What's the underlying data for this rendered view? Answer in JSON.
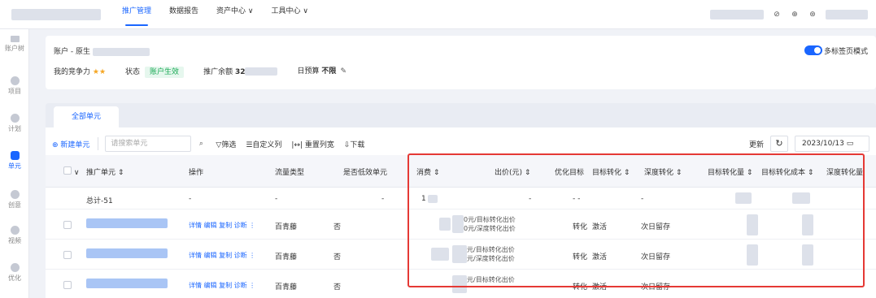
{
  "topbar": {
    "nav": [
      "推广管理",
      "数据报告",
      "资产中心 ∨",
      "工具中心 ∨"
    ],
    "icons": [
      "help-icon",
      "switch-icon",
      "user-icon"
    ]
  },
  "rail": [
    "账户树",
    "项目",
    "计划",
    "单元",
    "创意",
    "视频",
    "优化"
  ],
  "account": {
    "name_prefix": "账户 - 原生",
    "competitiveness_label": "我的竞争力",
    "stars": "★★",
    "status_label": "状态",
    "status_value": "账户生效",
    "balance_label": "推广余额",
    "balance_value": "32",
    "budget_label": "日预算",
    "budget_value": "不限",
    "multi_tab_label": "多标签页模式"
  },
  "tab": {
    "label": "全部单元"
  },
  "toolbar": {
    "new_label": "⊕ 新建单元",
    "search_placeholder": "请搜索单元",
    "filter": "▽筛选",
    "custom": "☰自定义列",
    "reset": "|↔| 重置列宽",
    "download": "⇩下载",
    "refresh_label": "更新",
    "date": "2023/10/13"
  },
  "table": {
    "headers": [
      "推广单元 ⇕",
      "操作",
      "流量类型",
      "是否低效单元",
      "消费 ⇕",
      "出价(元) ⇕",
      "优化目标",
      "目标转化 ⇕",
      "深度转化 ⇕",
      "目标转化量 ⇕",
      "目标转化成本 ⇕",
      "深度转化量"
    ],
    "total_label": "总计-51",
    "total_spend": "1",
    "rows": [
      {
        "ops": "详情 编辑 复制 诊断 ⋮",
        "traffic": "百青藤",
        "low": "否",
        "bid1": "0元/目标转化出价",
        "bid2": "0元/深度转化出价",
        "goal": "转化",
        "target": "激活",
        "deep": "次日留存"
      },
      {
        "ops": "详情 编辑 复制 诊断 ⋮",
        "traffic": "百青藤",
        "low": "否",
        "bid1": "元/目标转化出价",
        "bid2": "元/深度转化出价",
        "goal": "转化",
        "target": "激活",
        "deep": "次日留存"
      },
      {
        "ops": "详情 编辑 复制 诊断 ⋮",
        "traffic": "百青藤",
        "low": "否",
        "bid1": "元/目标转化出价",
        "bid2": "",
        "goal": "转化",
        "target": "激活",
        "deep": "次日留存"
      }
    ]
  },
  "colors": {
    "accent": "#1a66ff",
    "highlight_border": "#e53935",
    "status_green": "#1aaa55"
  }
}
